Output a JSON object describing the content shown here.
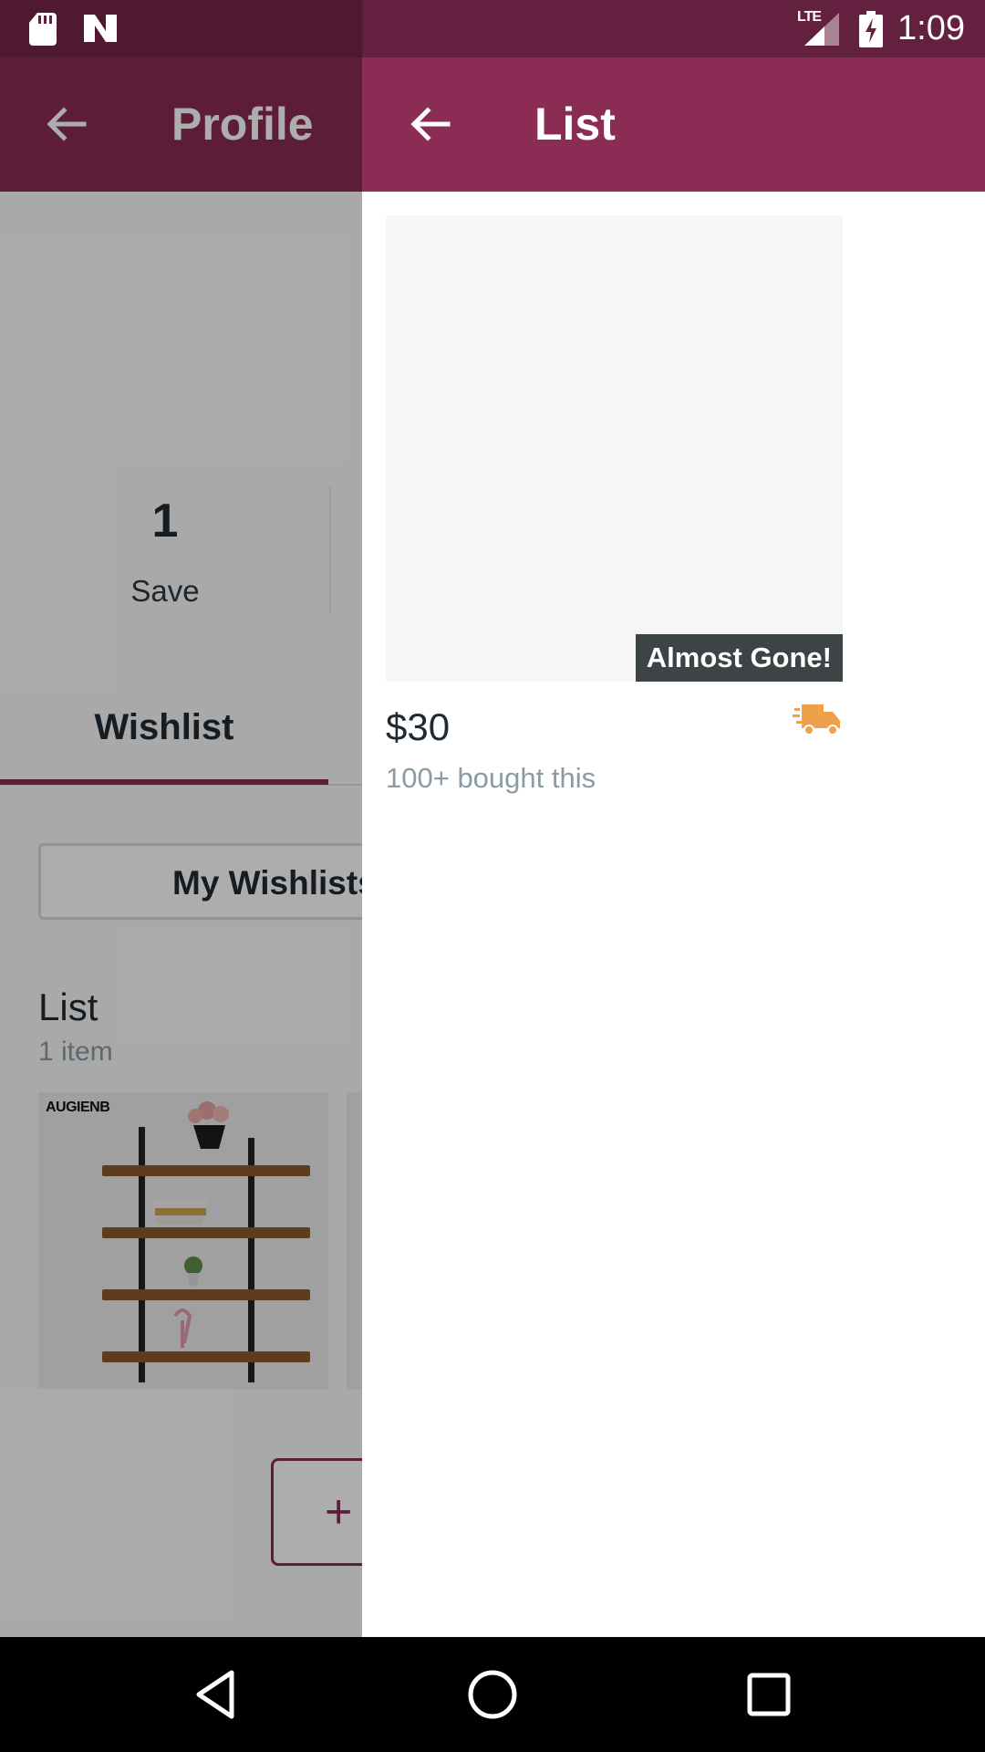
{
  "status_bar": {
    "network": "LTE",
    "time": "1:09",
    "icons": [
      "sd-card-icon",
      "n-notification-icon",
      "signal-icon",
      "battery-charging-icon"
    ]
  },
  "profile": {
    "title": "Profile",
    "stat_value": "1",
    "stat_label": "Save",
    "tab_label": "Wishlist",
    "my_wishlists_label": "My Wishlists",
    "list_name": "List",
    "list_count": "1 item",
    "thumb_brand": "AUGIENB",
    "add_label": "+"
  },
  "list_page": {
    "title": "List",
    "badge": "Almost Gone!",
    "price": "$30",
    "bought_text": "100+ bought this",
    "colors": {
      "accent": "#8a2c54",
      "badge_bg": "#3d4446",
      "truck": "#f0a04b"
    }
  },
  "nav": {
    "icons": [
      "back-triangle-icon",
      "home-circle-icon",
      "recents-square-icon"
    ]
  }
}
